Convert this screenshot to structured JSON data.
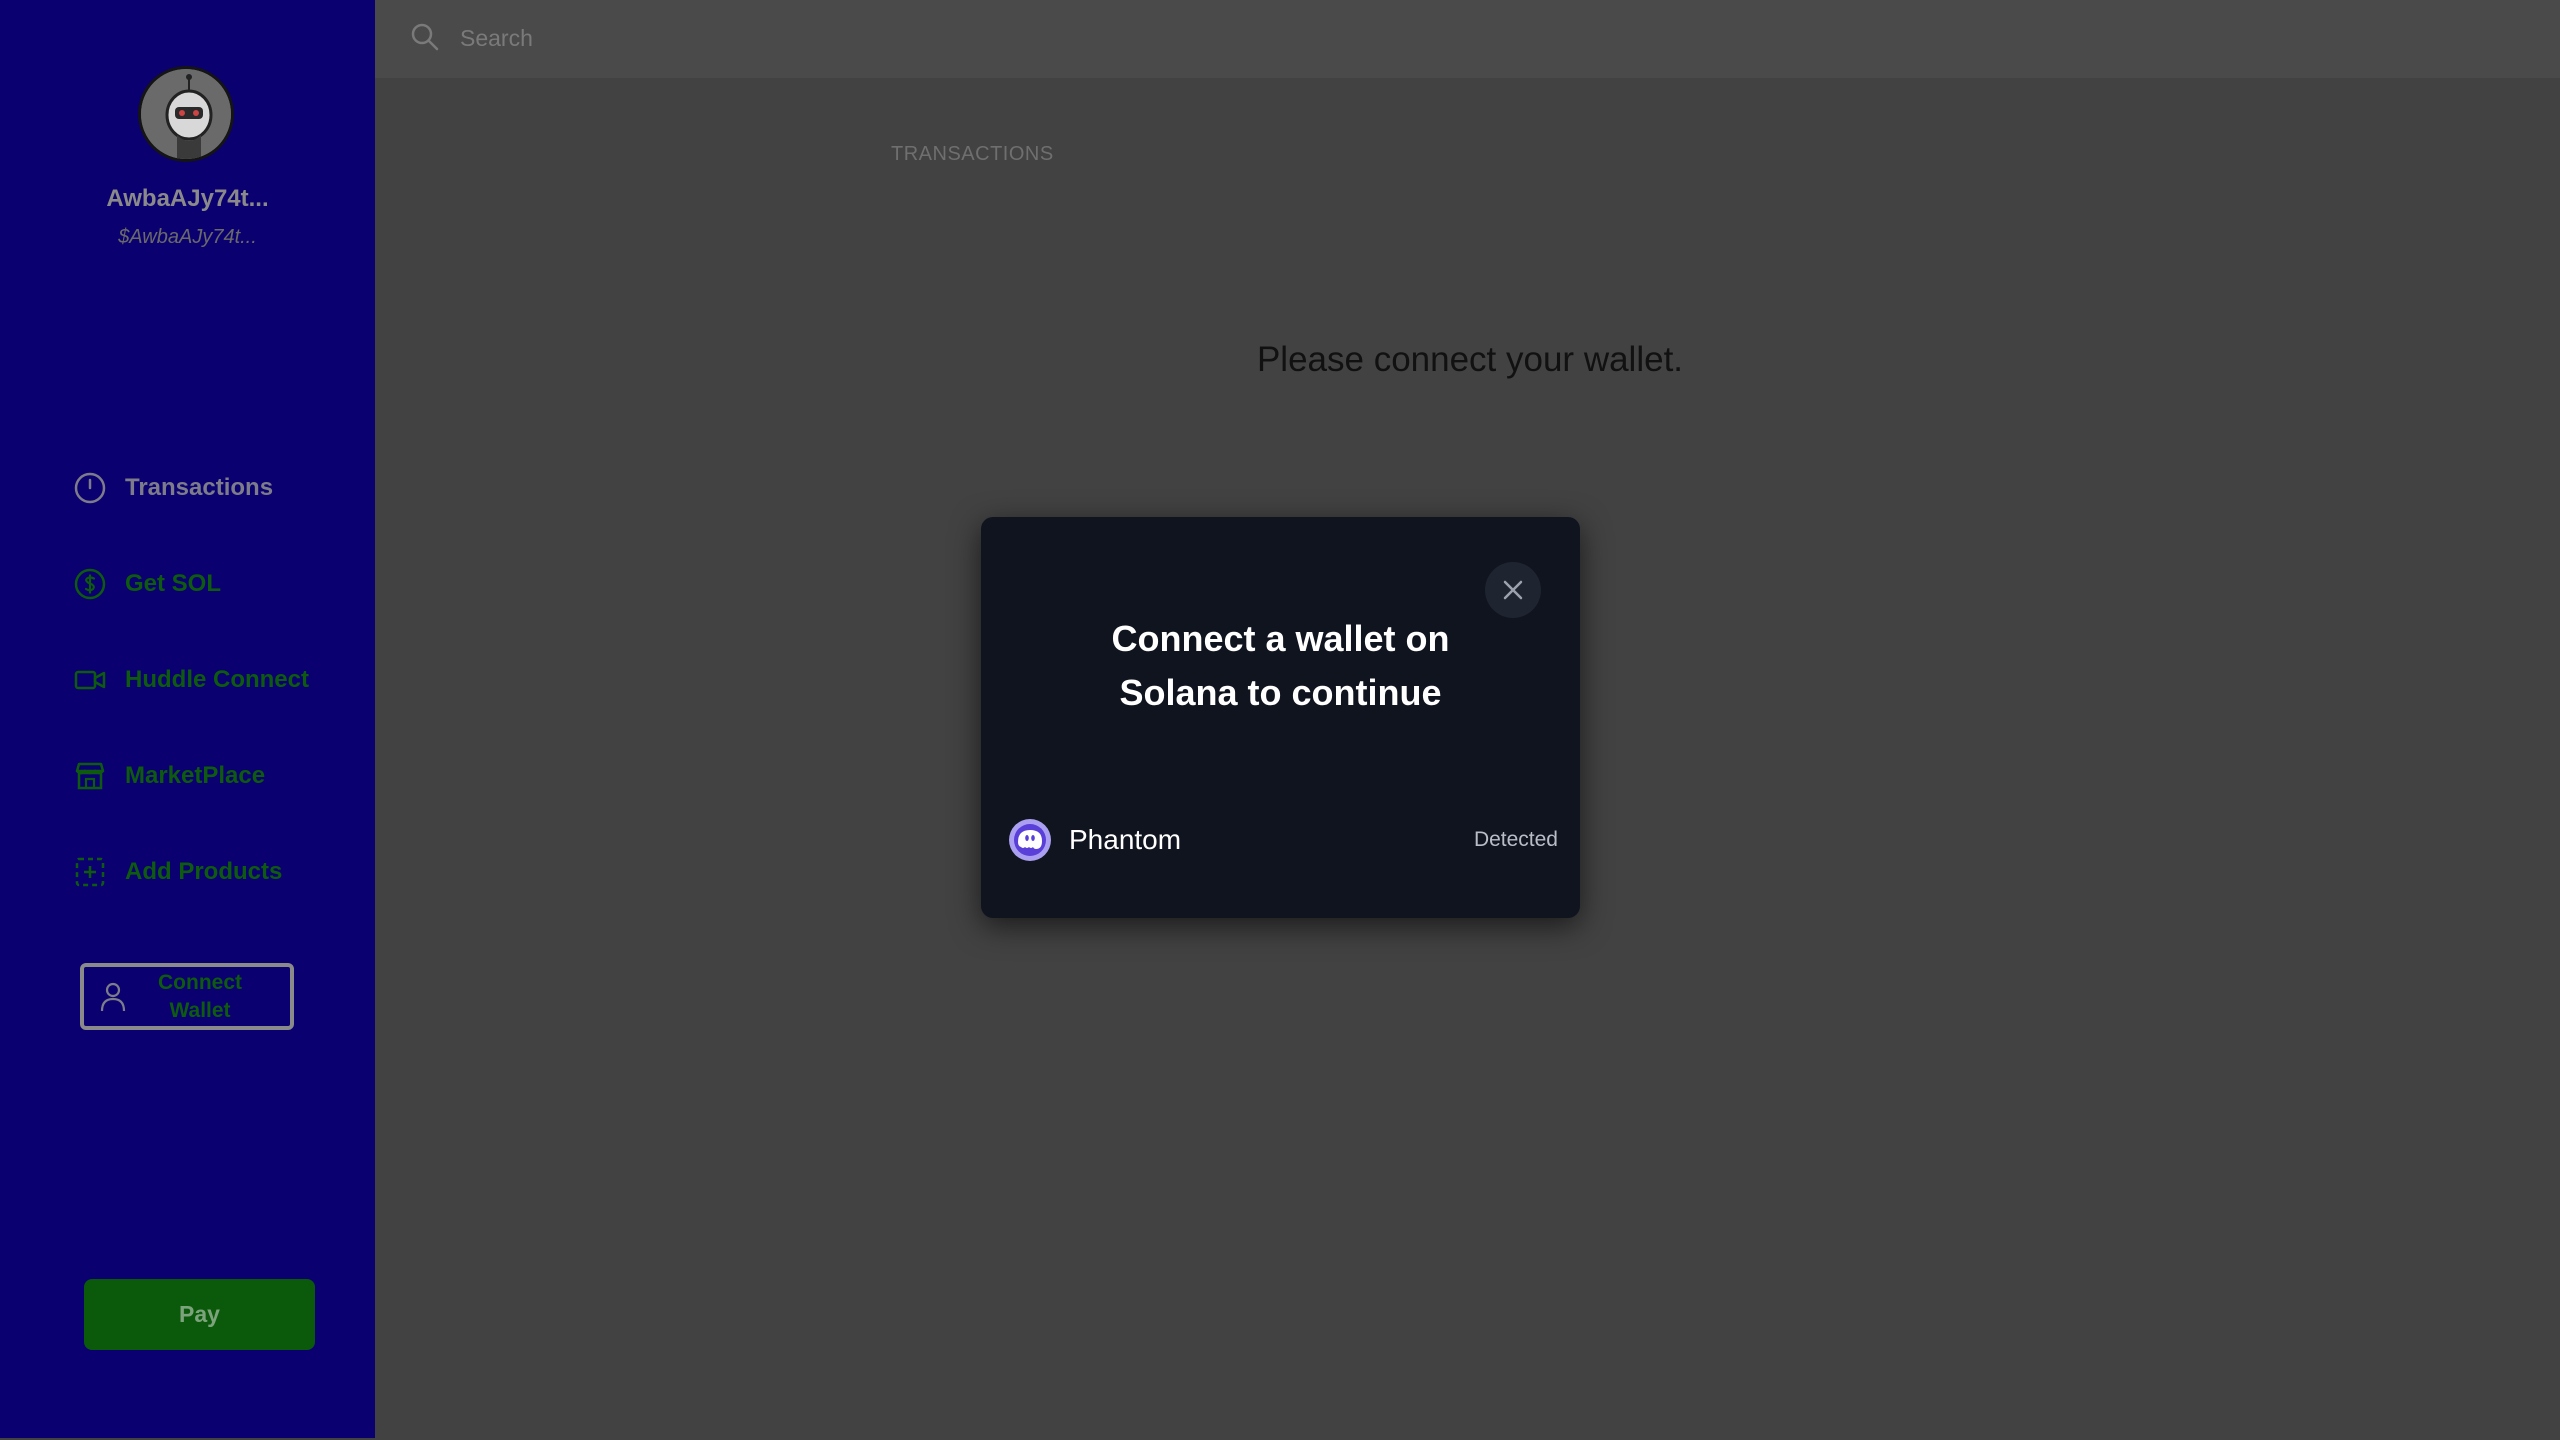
{
  "sidebar": {
    "profile": {
      "name": "AwbaAJy74t...",
      "handle": "$AwbaAJy74t..."
    },
    "nav_items": [
      {
        "label": "Transactions",
        "icon": "clock-icon"
      },
      {
        "label": "Get SOL",
        "icon": "dollar-circle-icon"
      },
      {
        "label": "Huddle Connect",
        "icon": "video-camera-icon"
      },
      {
        "label": "MarketPlace",
        "icon": "store-icon"
      },
      {
        "label": "Add Products",
        "icon": "add-square-icon"
      }
    ],
    "connect_wallet_label": "Connect Wallet",
    "pay_label": "Pay"
  },
  "topbar": {
    "search_placeholder": "Search"
  },
  "main": {
    "tab_label": "TRANSACTIONS",
    "message": "Please connect your wallet."
  },
  "modal": {
    "title": "Connect a wallet on Solana to continue",
    "wallets": [
      {
        "name": "Phantom",
        "status": "Detected",
        "icon": "phantom-logo-icon"
      }
    ]
  },
  "colors": {
    "sidebar_bg": "#0b0070",
    "page_bg": "#424242",
    "modal_bg": "#10141f",
    "accent_green": "#0b5a0b",
    "phantom_purple": "#ab9ff2"
  }
}
